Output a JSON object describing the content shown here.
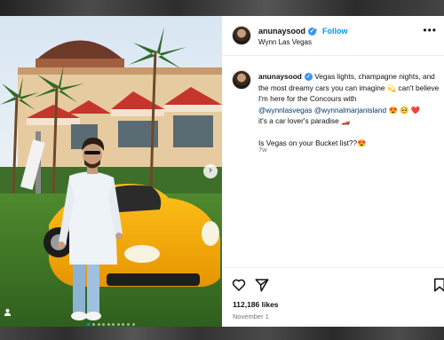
{
  "post": {
    "username": "anunaysood",
    "follow_label": "Follow",
    "location": "Wynn Las Vegas",
    "caption": {
      "username": "anunaysood",
      "text_1": "Vegas lights, champagne nights, and the most dreamy cars you can imagine 💫 can't believe I'm here for the Concours with",
      "mention_1": "@wynnlasvegas",
      "mention_2": "@wynnalmarjanisland",
      "emojis_1": "😍 🥺 ❤️",
      "text_2": "it's a car lover's paradise 🏎️",
      "question": "Is Vegas on your Bucket list??😍"
    },
    "age": "7w",
    "likes": "112,186 likes",
    "date": "November 1"
  },
  "media": {
    "next_icon": "chevron-right-icon",
    "carousel_count": 10,
    "carousel_active": 0
  },
  "colors": {
    "accent": "#0095f6",
    "mention": "#00376b",
    "car": "#f6a800"
  }
}
